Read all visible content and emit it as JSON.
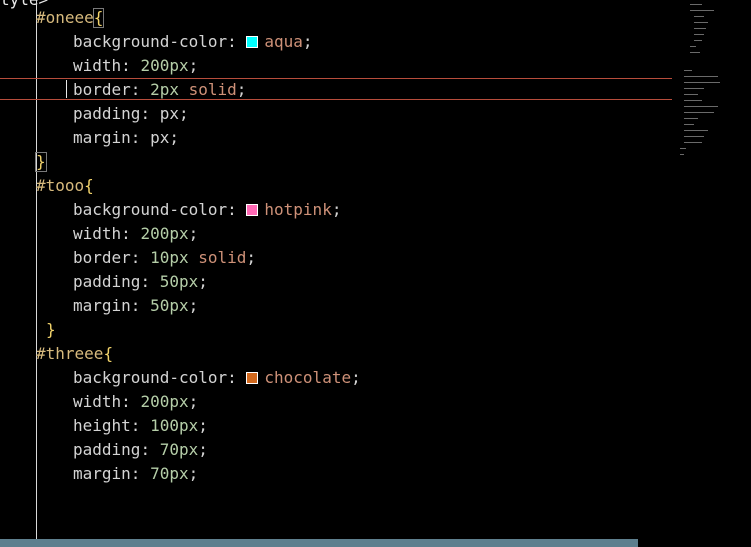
{
  "editor": {
    "top_fragment": "tyle>",
    "lines": [
      {
        "kind": "selector",
        "text": "#oneee",
        "brace": "{",
        "brace_boxed": true
      },
      {
        "kind": "decl",
        "prop": "background-color",
        "swatch": "#00ffff",
        "value_parts": [
          {
            "t": "ident",
            "v": "aqua"
          }
        ],
        "semi": ";"
      },
      {
        "kind": "decl",
        "prop": "width",
        "value_parts": [
          {
            "t": "num",
            "v": "200px"
          }
        ],
        "semi": ";"
      },
      {
        "kind": "decl",
        "prop": "border",
        "value_parts": [
          {
            "t": "num",
            "v": "2px"
          },
          {
            "t": "space",
            "v": " "
          },
          {
            "t": "ident",
            "v": "solid"
          }
        ],
        "semi": ";"
      },
      {
        "kind": "decl",
        "prop": "padding",
        "value_parts": [
          {
            "t": "plain",
            "v": "px"
          }
        ],
        "semi": ";"
      },
      {
        "kind": "decl",
        "prop": "margin",
        "value_parts": [
          {
            "t": "plain",
            "v": "px"
          }
        ],
        "semi": ";"
      },
      {
        "kind": "close",
        "brace": "}",
        "brace_boxed": true
      },
      {
        "kind": "selector",
        "text": "#tooo",
        "brace": "{",
        "brace_boxed": false
      },
      {
        "kind": "decl",
        "prop": "background-color",
        "swatch": "#ff69b4",
        "value_parts": [
          {
            "t": "ident",
            "v": "hotpink"
          }
        ],
        "semi": ";"
      },
      {
        "kind": "decl",
        "prop": "width",
        "value_parts": [
          {
            "t": "num",
            "v": "200px"
          }
        ],
        "semi": ";"
      },
      {
        "kind": "decl",
        "prop": "border",
        "value_parts": [
          {
            "t": "num",
            "v": "10px"
          },
          {
            "t": "space",
            "v": " "
          },
          {
            "t": "ident",
            "v": "solid"
          }
        ],
        "semi": ";"
      },
      {
        "kind": "decl",
        "prop": "padding",
        "value_parts": [
          {
            "t": "num",
            "v": "50px"
          }
        ],
        "semi": ";"
      },
      {
        "kind": "decl",
        "prop": "margin",
        "value_parts": [
          {
            "t": "num",
            "v": "50px"
          }
        ],
        "semi": ";"
      },
      {
        "kind": "close",
        "brace": "}",
        "brace_boxed": false
      },
      {
        "kind": "selector",
        "text": "#threee",
        "brace": "{",
        "brace_boxed": false
      },
      {
        "kind": "decl",
        "prop": "background-color",
        "swatch": "#d2691e",
        "value_parts": [
          {
            "t": "ident",
            "v": "chocolate"
          }
        ],
        "semi": ";"
      },
      {
        "kind": "decl",
        "prop": "width",
        "value_parts": [
          {
            "t": "num",
            "v": "200px"
          }
        ],
        "semi": ";"
      },
      {
        "kind": "decl",
        "prop": "height",
        "value_parts": [
          {
            "t": "num",
            "v": "100px"
          }
        ],
        "semi": ";"
      },
      {
        "kind": "decl",
        "prop": "padding",
        "value_parts": [
          {
            "t": "num",
            "v": "70px"
          }
        ],
        "semi": ";"
      },
      {
        "kind": "decl",
        "prop": "margin",
        "value_parts": [
          {
            "t": "num",
            "v": "70px"
          }
        ],
        "semi": ";"
      },
      {
        "kind": "blank"
      },
      {
        "kind": "blank"
      },
      {
        "kind": "close",
        "brace": "}",
        "brace_boxed": false
      }
    ],
    "current_line_index": 3
  },
  "colors": {
    "aqua": "#00ffff",
    "hotpink": "#ff69b4",
    "chocolate": "#d2691e",
    "current_line_border": "#b84d3c",
    "status_bar": "#5e7f8e"
  }
}
